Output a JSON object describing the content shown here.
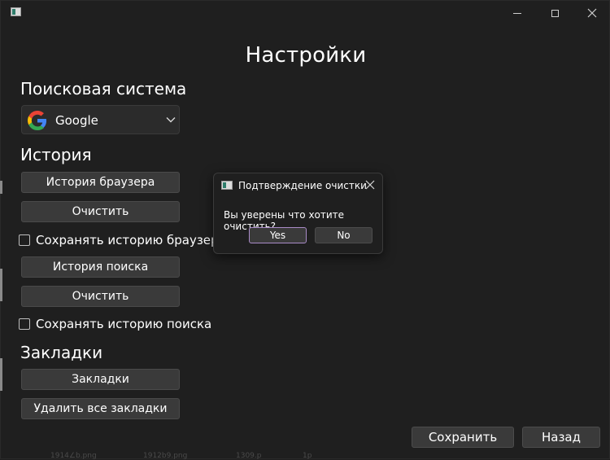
{
  "window": {
    "controls": [
      "minimize-icon",
      "maximize-icon",
      "close-icon"
    ]
  },
  "settings": {
    "title": "Настройки",
    "search_section": "Поисковая система",
    "search_engine": {
      "selected": "Google",
      "icon": "google-logo-icon"
    },
    "history_section": "История",
    "browser_history_button": "История браузера",
    "clear_browser_history_button": "Очистить",
    "save_browser_history_label": "Сохранять историю браузера",
    "save_browser_history_checked": false,
    "search_history_button": "История поиска",
    "clear_search_history_button": "Очистить",
    "save_search_history_label": "Сохранять историю поиска",
    "save_search_history_checked": false,
    "bookmarks_section": "Закладки",
    "bookmarks_button": "Закладки",
    "delete_bookmarks_button": "Удалить все закладки",
    "save_button": "Сохранить",
    "back_button": "Назад"
  },
  "dialog": {
    "title": "Подтверждение очистки",
    "message": "Вы уверены что хотите очистить?",
    "yes_label": "Yes",
    "no_label": "No"
  },
  "background_window": {
    "file_labels": [
      "1914∠b.png",
      "1912b9.png",
      "1309.p",
      "1p"
    ]
  },
  "colors": {
    "background": "#1f1f1f",
    "button": "#3a3a3a",
    "dialog_default_border": "#a98bc7",
    "google_blue": "#4285F4",
    "google_red": "#EA4335",
    "google_yellow": "#FBBC05",
    "google_green": "#34A853"
  }
}
